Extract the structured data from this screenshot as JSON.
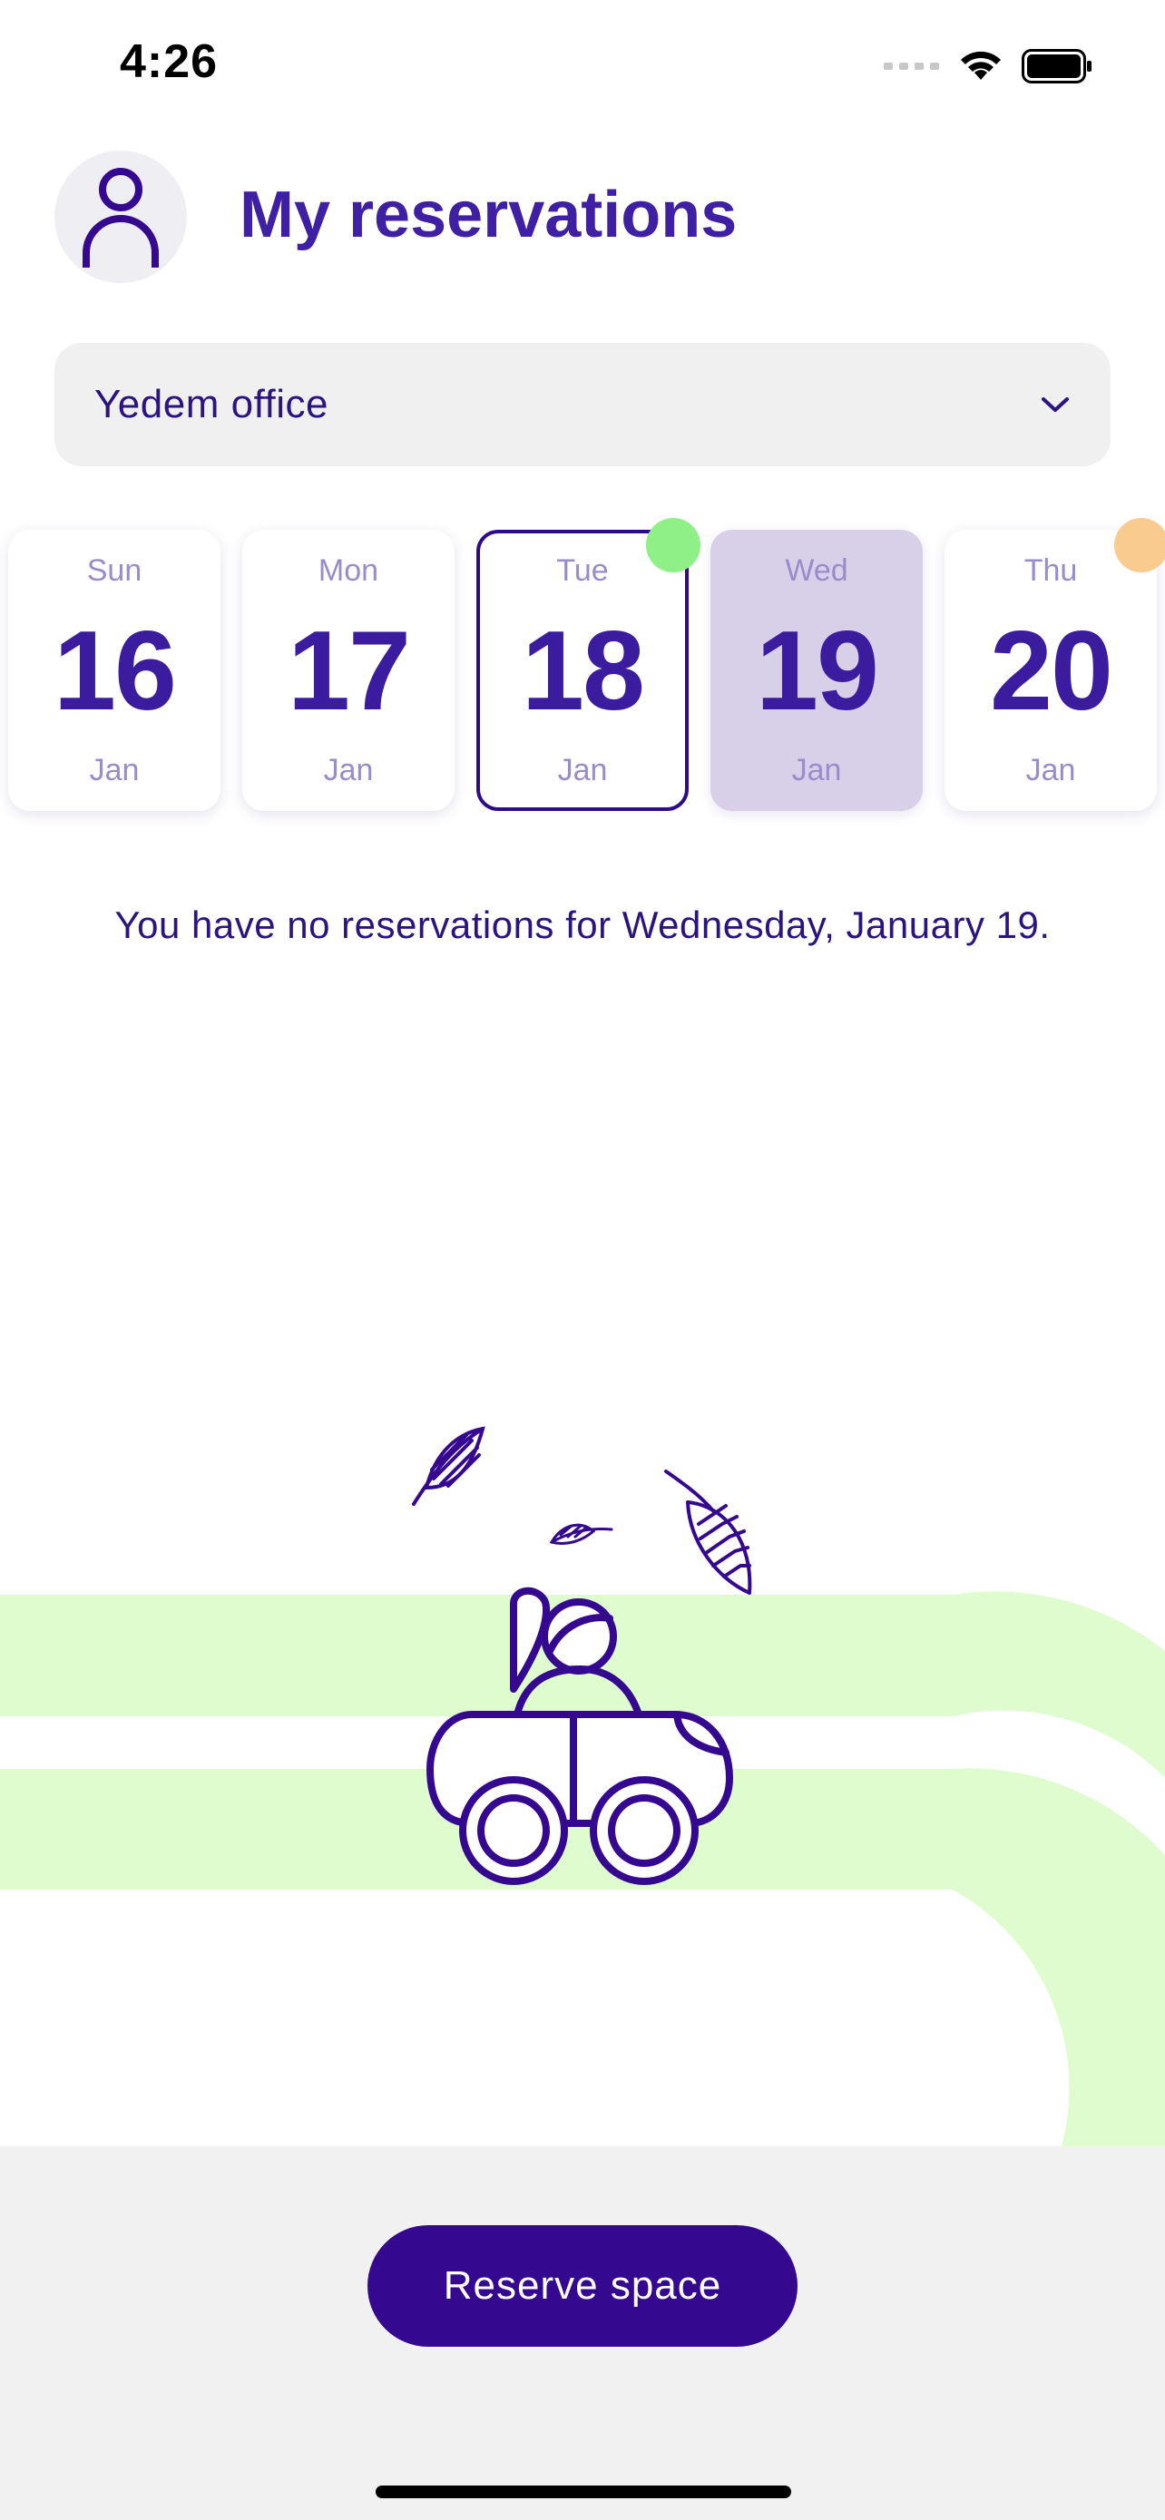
{
  "status_bar": {
    "time": "4:26",
    "icons": [
      "signal-icon",
      "wifi-icon",
      "battery-icon"
    ]
  },
  "header": {
    "title": "My reservations",
    "avatar_icon": "user-icon"
  },
  "office_selector": {
    "selected": "Yedem office",
    "icon": "chevron-down-icon"
  },
  "dates": [
    {
      "day": "Sun",
      "number": "16",
      "month": "Jan",
      "state": "default"
    },
    {
      "day": "Mon",
      "number": "17",
      "month": "Jan",
      "state": "default"
    },
    {
      "day": "Tue",
      "number": "18",
      "month": "Jan",
      "state": "today",
      "indicator_color": "#8ef086"
    },
    {
      "day": "Wed",
      "number": "19",
      "month": "Jan",
      "state": "selected"
    },
    {
      "day": "Thu",
      "number": "20",
      "month": "Jan",
      "state": "default",
      "indicator_color": "#f9cb8f"
    }
  ],
  "message": "You have no reservations for Wednesday, January 19.",
  "actions": {
    "reserve_label": "Reserve space"
  },
  "colors": {
    "primary": "#34098f",
    "title": "#3f1fa3",
    "accent_green": "#dffccf",
    "selected_card": "#d8cfe9"
  }
}
